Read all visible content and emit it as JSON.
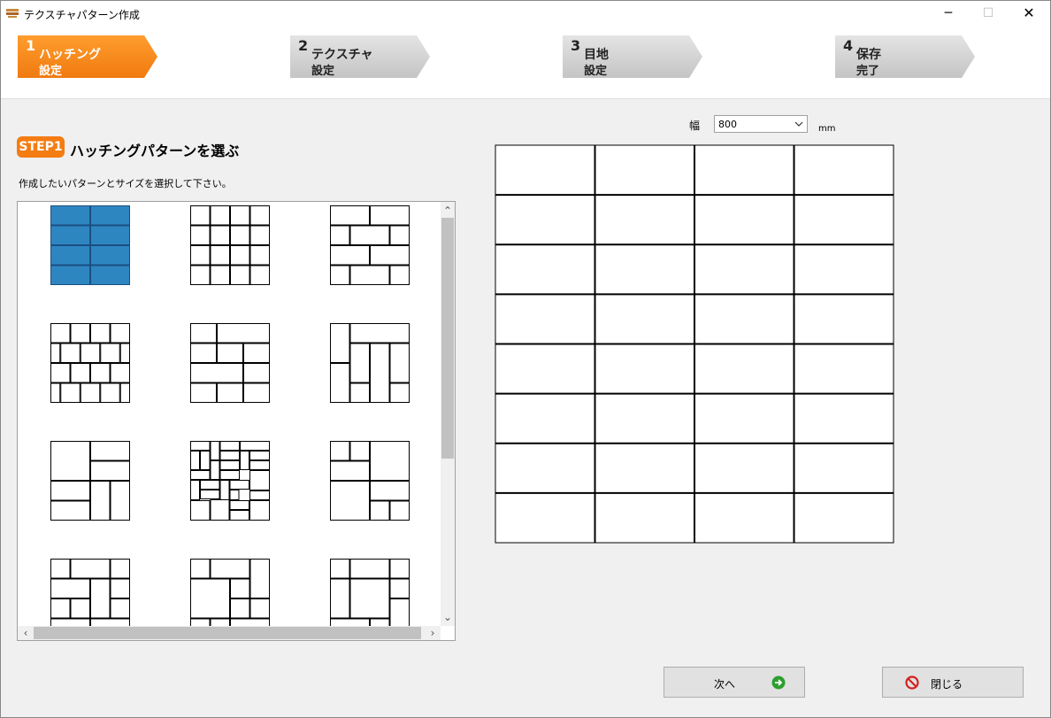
{
  "window": {
    "title": "テクスチャパターン作成",
    "minimize_glyph": "─",
    "maximize_glyph": "☐",
    "close_glyph": "✕"
  },
  "steps": [
    {
      "num": "1",
      "line1": "ハッチング",
      "line2": "設定",
      "active": true
    },
    {
      "num": "2",
      "line1": "テクスチャ",
      "line2": "設定",
      "active": false
    },
    {
      "num": "3",
      "line1": "目地",
      "line2": "設定",
      "active": false
    },
    {
      "num": "4",
      "line1": "保存",
      "line2": "完了",
      "active": false
    }
  ],
  "step_heading": {
    "badge": "STEP1",
    "title": "ハッチングパターンを選ぶ",
    "instruction": "作成したいパターンとサイズを選択して下さい。"
  },
  "gallery": {
    "selected_index": 0,
    "patterns": [
      "grid-2x4-selected",
      "grid-4x4",
      "running-bond-large",
      "running-bond-small",
      "running-bond-wide",
      "basketweave-bordered",
      "pinwheel-large",
      "herringbone-small",
      "pinwheel-square",
      "mixed-grid-a",
      "mixed-grid-b",
      "mixed-grid-c"
    ],
    "scroll_up": "⌃",
    "scroll_down": "⌄",
    "scroll_left": "‹",
    "scroll_right": "›"
  },
  "size": {
    "label": "幅",
    "value": "800",
    "unit": "mm"
  },
  "preview": {
    "columns": 4,
    "rows": 8
  },
  "buttons": {
    "next_label": "次へ",
    "close_label": "閉じる"
  },
  "colors": {
    "accent": "#f47c12",
    "selected_fill": "#2e86c1",
    "inactive_step": "#cfcfcf",
    "next_icon": "#2e9e2e",
    "close_icon": "#d42020"
  }
}
